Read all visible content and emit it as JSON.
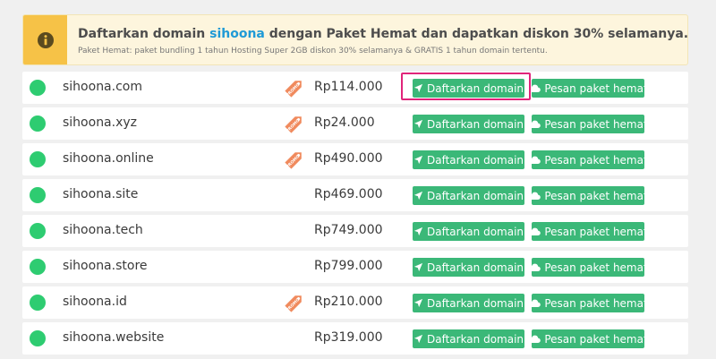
{
  "banner": {
    "title_before": "Daftarkan domain ",
    "brand": "sihoona",
    "title_after": " dengan Paket Hemat dan dapatkan diskon 30% selamanya.",
    "subtitle": "Paket Hemat: paket bundling 1 tahun Hosting Super 2GB diskon 30% selamanya & GRATIS 1 tahun domain tertentu.",
    "icon": "info-icon",
    "accent_color": "#f6c247"
  },
  "buttons": {
    "register_label": "Daftarkan domain",
    "package_label": "Pesan paket hemat"
  },
  "promo_tag_text": "PROMO",
  "domains": [
    {
      "name": "sihoona.com",
      "price": "Rp114.000",
      "promo": true,
      "available": true
    },
    {
      "name": "sihoona.xyz",
      "price": "Rp24.000",
      "promo": true,
      "available": true
    },
    {
      "name": "sihoona.online",
      "price": "Rp490.000",
      "promo": true,
      "available": true
    },
    {
      "name": "sihoona.site",
      "price": "Rp469.000",
      "promo": false,
      "available": true
    },
    {
      "name": "sihoona.tech",
      "price": "Rp749.000",
      "promo": false,
      "available": true
    },
    {
      "name": "sihoona.store",
      "price": "Rp799.000",
      "promo": false,
      "available": true
    },
    {
      "name": "sihoona.id",
      "price": "Rp210.000",
      "promo": true,
      "available": true
    },
    {
      "name": "sihoona.website",
      "price": "Rp319.000",
      "promo": false,
      "available": true
    }
  ],
  "colors": {
    "available_dot": "#2ecc71",
    "button_green": "#3bb878",
    "promo_orange": "#f08a5d",
    "highlight": "#e0247a"
  }
}
